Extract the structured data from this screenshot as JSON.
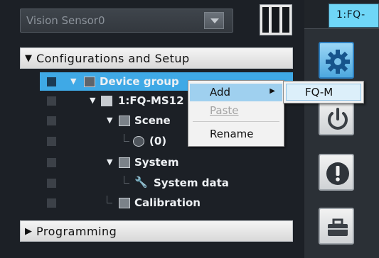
{
  "sensor_select": {
    "value": "Vision Sensor0"
  },
  "tree": {
    "configurations_header": "Configurations and Setup",
    "programming_header": "Programming",
    "items": [
      {
        "label": "Device group"
      },
      {
        "label": "1:FQ-MS12"
      },
      {
        "label": "Scene"
      },
      {
        "label": "(0)"
      },
      {
        "label": "System"
      },
      {
        "label": "System data"
      },
      {
        "label": "Calibration"
      }
    ]
  },
  "context_menu": {
    "items": [
      {
        "label": "Add",
        "state": "highlighted"
      },
      {
        "label": "Paste",
        "state": "disabled"
      },
      {
        "label": "Rename",
        "state": "enabled"
      }
    ]
  },
  "submenu": {
    "items": [
      {
        "label": "FQ-M"
      }
    ]
  },
  "right_panel": {
    "tab_label": "1:FQ-",
    "tools": [
      "gear-icon",
      "power-icon",
      "alert-icon",
      "toolbox-icon"
    ]
  },
  "colors": {
    "selection": "#3fa9e6",
    "accent": "#6fd6f7",
    "menu_highlight": "#9fd0ef"
  }
}
